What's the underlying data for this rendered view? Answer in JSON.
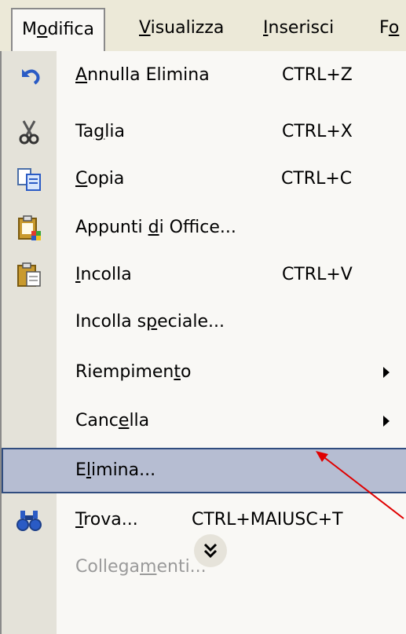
{
  "menubar": {
    "items": [
      {
        "label": "Modifica",
        "mnemonic_index": 1,
        "active": true
      },
      {
        "label": "Visualizza",
        "mnemonic_index": 0
      },
      {
        "label": "Inserisci",
        "mnemonic_index": 0
      },
      {
        "label": "Fo",
        "mnemonic_index": 1
      }
    ]
  },
  "menu": {
    "items": [
      {
        "pre": "",
        "u": "A",
        "post": "nnulla Elimina",
        "shortcut": "CTRL+Z",
        "icon": "undo-icon"
      },
      {
        "pre": "Ta",
        "u": "g",
        "post": "lia",
        "shortcut": "CTRL+X",
        "icon": "scissors-icon"
      },
      {
        "pre": "",
        "u": "C",
        "post": "opia",
        "shortcut": "CTRL+C",
        "icon": "copy-icon"
      },
      {
        "pre": "Appunti ",
        "u": "d",
        "post": "i Office...",
        "shortcut": "",
        "icon": "office-clipboard-icon"
      },
      {
        "pre": "",
        "u": "I",
        "post": "ncolla",
        "shortcut": "CTRL+V",
        "icon": "paste-icon"
      },
      {
        "pre": "Incolla s",
        "u": "p",
        "post": "eciale...",
        "shortcut": "",
        "icon": ""
      },
      {
        "pre": "Riempimen",
        "u": "t",
        "post": "o",
        "shortcut": "",
        "icon": "",
        "submenu": true
      },
      {
        "pre": "Canc",
        "u": "e",
        "post": "lla",
        "shortcut": "",
        "icon": "",
        "submenu": true
      },
      {
        "pre": "E",
        "u": "l",
        "post": "imina...",
        "shortcut": "",
        "icon": "",
        "highlighted": true
      },
      {
        "pre": "",
        "u": "T",
        "post": "rova...",
        "shortcut": "CTRL+MAIUSC+T",
        "icon": "binoculars-icon"
      },
      {
        "pre": "Collega",
        "u": "m",
        "post": "enti...",
        "shortcut": "",
        "icon": "",
        "disabled": true
      }
    ],
    "expand_icon": "double-chevron-down-icon"
  },
  "colors": {
    "highlight_bg": "#b6bdd2",
    "highlight_border": "#314d7f",
    "annotation_arrow": "#e00000",
    "icon_column": "#e4e2d9"
  }
}
